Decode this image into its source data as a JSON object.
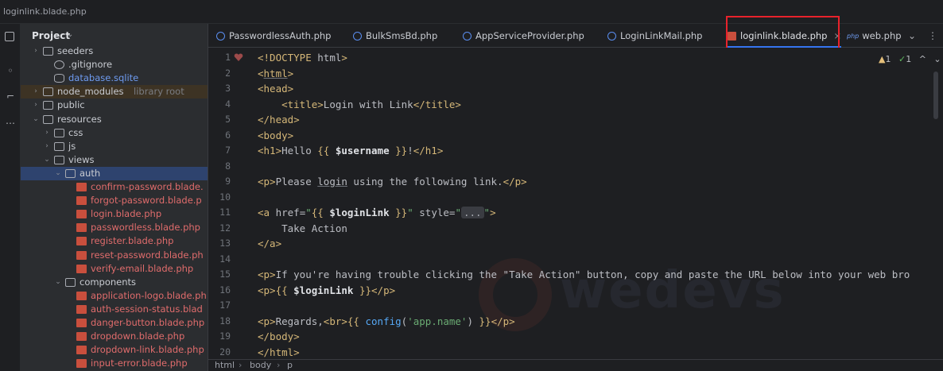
{
  "window": {
    "title": "loginlink.blade.php"
  },
  "project_panel": {
    "title": "Project",
    "tree": [
      {
        "name": "seeders",
        "type": "folder",
        "color": "norm",
        "indent": 1,
        "arrow": "›"
      },
      {
        "name": ".gitignore",
        "type": "git",
        "color": "norm",
        "indent": 2
      },
      {
        "name": "database.sqlite",
        "type": "db",
        "color": "blue",
        "indent": 2
      },
      {
        "name": "node_modules",
        "sub": "library root",
        "type": "folder",
        "color": "norm",
        "indent": 1,
        "arrow": "›",
        "lib": true
      },
      {
        "name": "public",
        "type": "folder",
        "color": "norm",
        "indent": 1,
        "arrow": "›"
      },
      {
        "name": "resources",
        "type": "folder",
        "color": "norm",
        "indent": 1,
        "arrow": "⌄"
      },
      {
        "name": "css",
        "type": "folder",
        "color": "norm",
        "indent": 2,
        "arrow": "›"
      },
      {
        "name": "js",
        "type": "folder",
        "color": "norm",
        "indent": 2,
        "arrow": "›"
      },
      {
        "name": "views",
        "type": "folder",
        "color": "norm",
        "indent": 2,
        "arrow": "⌄"
      },
      {
        "name": "auth",
        "type": "folder",
        "color": "norm",
        "indent": 3,
        "arrow": "⌄",
        "selected": true
      },
      {
        "name": "confirm-password.blade.",
        "type": "file",
        "color": "red",
        "indent": 4
      },
      {
        "name": "forgot-password.blade.p",
        "type": "file",
        "color": "red",
        "indent": 4
      },
      {
        "name": "login.blade.php",
        "type": "file",
        "color": "red",
        "indent": 4
      },
      {
        "name": "passwordless.blade.php",
        "type": "file",
        "color": "red",
        "indent": 4
      },
      {
        "name": "register.blade.php",
        "type": "file",
        "color": "red",
        "indent": 4
      },
      {
        "name": "reset-password.blade.ph",
        "type": "file",
        "color": "red",
        "indent": 4
      },
      {
        "name": "verify-email.blade.php",
        "type": "file",
        "color": "red",
        "indent": 4
      },
      {
        "name": "components",
        "type": "folder",
        "color": "norm",
        "indent": 3,
        "arrow": "⌄"
      },
      {
        "name": "application-logo.blade.ph",
        "type": "file",
        "color": "red",
        "indent": 4
      },
      {
        "name": "auth-session-status.blad",
        "type": "file",
        "color": "red",
        "indent": 4
      },
      {
        "name": "danger-button.blade.php",
        "type": "file",
        "color": "red",
        "indent": 4
      },
      {
        "name": "dropdown.blade.php",
        "type": "file",
        "color": "red",
        "indent": 4
      },
      {
        "name": "dropdown-link.blade.php",
        "type": "file",
        "color": "red",
        "indent": 4
      },
      {
        "name": "input-error.blade.php",
        "type": "file",
        "color": "red",
        "indent": 4
      }
    ]
  },
  "tabs": [
    {
      "label": "PasswordlessAuth.php",
      "icon": "class-icon"
    },
    {
      "label": "BulkSmsBd.php",
      "icon": "class-icon"
    },
    {
      "label": "AppServiceProvider.php",
      "icon": "class-icon"
    },
    {
      "label": "LoginLinkMail.php",
      "icon": "class-icon"
    },
    {
      "label": "loginlink.blade.php",
      "icon": "blade-icon",
      "active": true,
      "close": "×"
    },
    {
      "label": "web.php",
      "icon": "php-icon",
      "icon_text": "php"
    }
  ],
  "inspections": {
    "warnings": "1",
    "checks": "1"
  },
  "editor": {
    "line_numbers": [
      "1",
      "2",
      "3",
      "4",
      "5",
      "6",
      "7",
      "8",
      "9",
      "10",
      "11",
      "12",
      "13",
      "14",
      "15",
      "16",
      "17",
      "18",
      "19",
      "20"
    ],
    "fold_placeholder": "..."
  },
  "watermark": {
    "text": "wedevs"
  },
  "breadcrumb": [
    "html",
    "body",
    "p"
  ],
  "colors": {
    "accent": "#3574f0",
    "highlight_box": "#e8222b",
    "tag": "#d5b778",
    "string": "#6aab73",
    "function": "#56a8f5",
    "file_red": "#e06c6c"
  }
}
